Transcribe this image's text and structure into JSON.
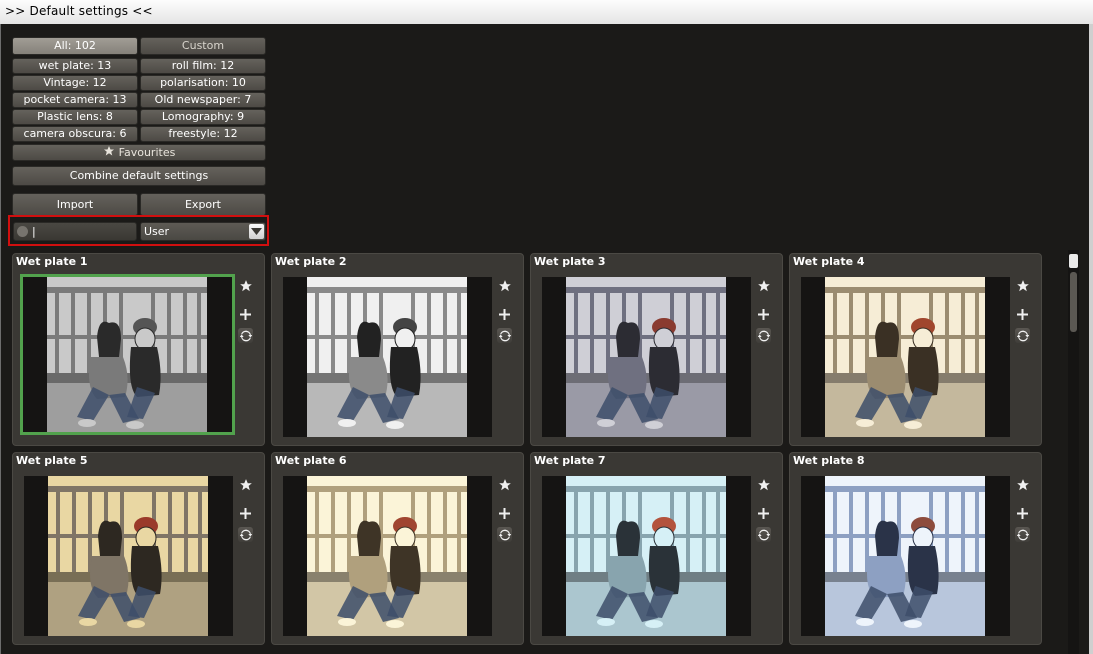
{
  "window": {
    "title": ">> Default settings <<"
  },
  "filters": [
    {
      "label": "All: 102",
      "selected": true
    },
    {
      "label": "Custom"
    },
    {
      "label": "wet plate: 13"
    },
    {
      "label": "roll film: 12"
    },
    {
      "label": "Vintage: 12"
    },
    {
      "label": "polarisation: 10"
    },
    {
      "label": "pocket camera: 13"
    },
    {
      "label": "Old newspaper: 7"
    },
    {
      "label": "Plastic lens: 8"
    },
    {
      "label": "Lomography: 9"
    },
    {
      "label": "camera obscura: 6"
    },
    {
      "label": "freestyle: 12"
    }
  ],
  "favourites": {
    "label": "Favourites",
    "icon": "star-icon"
  },
  "combine": {
    "label": "Combine default settings"
  },
  "import": {
    "label": "Import"
  },
  "export": {
    "label": "Export"
  },
  "search": {
    "value": "",
    "placeholder": ""
  },
  "user_select": {
    "value": "User"
  },
  "presets": [
    {
      "name": "Wet plate 1",
      "tone": "bw",
      "active": true
    },
    {
      "name": "Wet plate 2",
      "tone": "bw-bright"
    },
    {
      "name": "Wet plate 3",
      "tone": "cool-muted"
    },
    {
      "name": "Wet plate 4",
      "tone": "warm"
    },
    {
      "name": "Wet plate 5",
      "tone": "warm-dark"
    },
    {
      "name": "Wet plate 6",
      "tone": "cream"
    },
    {
      "name": "Wet plate 7",
      "tone": "cyan"
    },
    {
      "name": "Wet plate 8",
      "tone": "blue"
    }
  ],
  "colors": {
    "accent_active": "#52a24d",
    "highlight": "#d10f0f",
    "background": "#1b1a18"
  }
}
